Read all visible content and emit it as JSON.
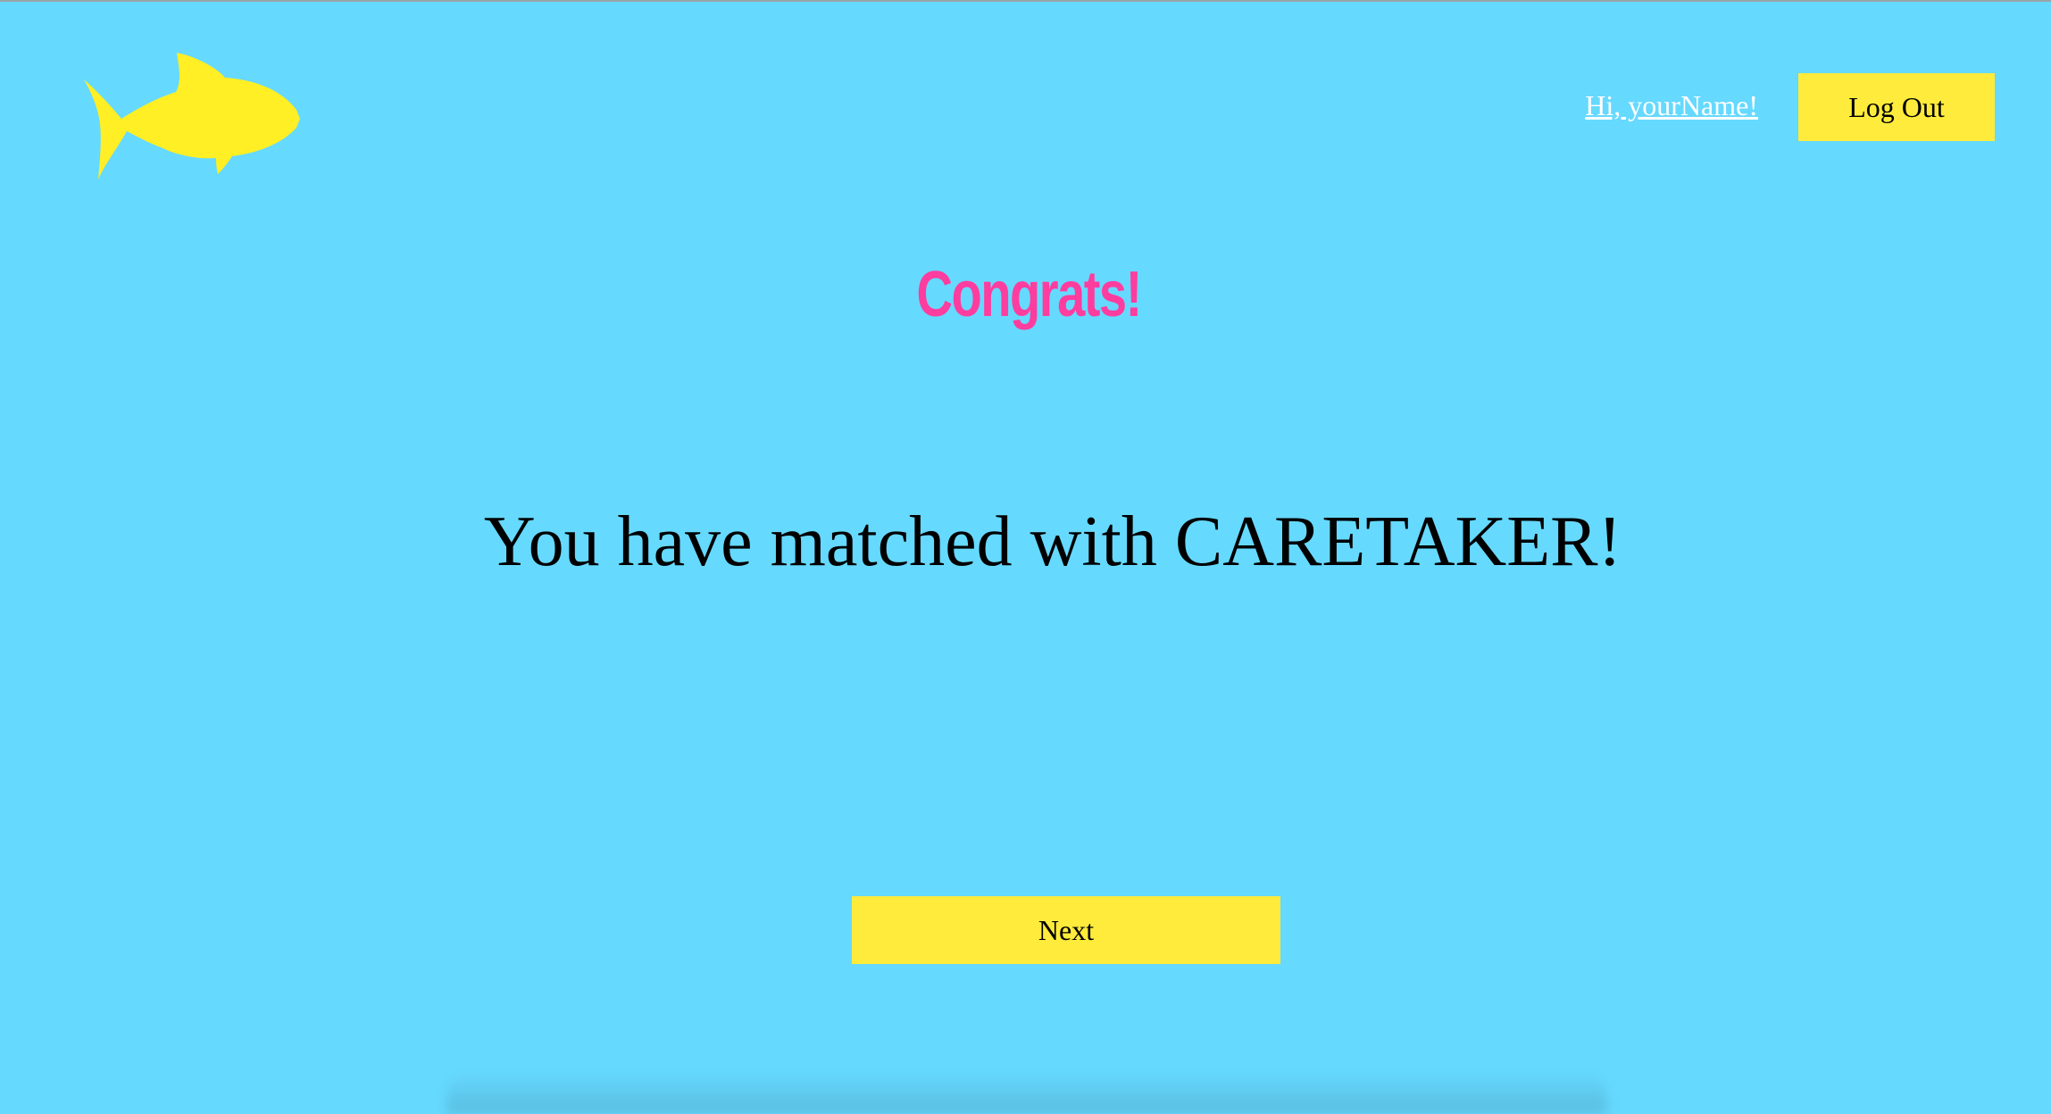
{
  "header": {
    "logo_icon": "fish-icon",
    "logo_color": "#ffef24",
    "greeting": "Hi, yourName!",
    "logout_label": "Log Out"
  },
  "main": {
    "title": "Congrats!",
    "message": "You have matched with CARETAKER!",
    "next_label": "Next"
  },
  "colors": {
    "background": "#66d9ff",
    "button": "#ffeb3b",
    "title": "#ff3d9e",
    "link": "#ffffff"
  }
}
